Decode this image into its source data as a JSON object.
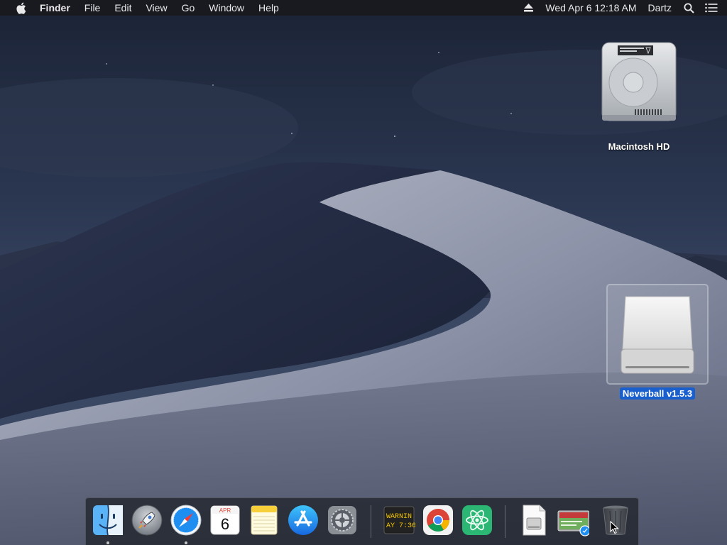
{
  "menubar": {
    "app_name": "Finder",
    "items": [
      "File",
      "Edit",
      "View",
      "Go",
      "Window",
      "Help"
    ],
    "datetime": "Wed Apr 6  12:18 AM",
    "user": "Dartz"
  },
  "desktop": {
    "macintosh_hd": "Macintosh HD",
    "neverball": "Neverball v1.5.3"
  },
  "dock": {
    "calendar_month": "APR",
    "calendar_day": "6",
    "console_line1": "WARNIN",
    "console_line2": "AY 7:36"
  },
  "colors": {
    "selection": "#1a5fce",
    "menubar": "#181a1e"
  }
}
